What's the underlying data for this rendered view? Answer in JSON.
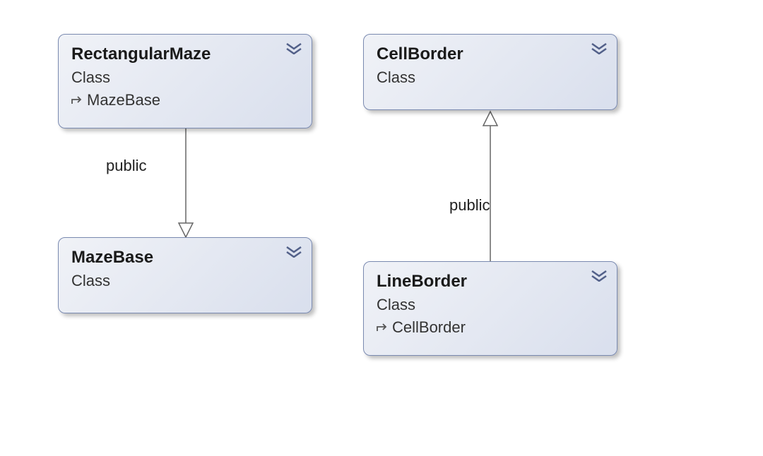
{
  "classes": {
    "rectangularMaze": {
      "name": "RectangularMaze",
      "type": "Class",
      "inherits": "MazeBase"
    },
    "mazeBase": {
      "name": "MazeBase",
      "type": "Class"
    },
    "cellBorder": {
      "name": "CellBorder",
      "type": "Class"
    },
    "lineBorder": {
      "name": "LineBorder",
      "type": "Class",
      "inherits": "CellBorder"
    }
  },
  "relations": {
    "left": {
      "label": "public",
      "from": "RectangularMaze",
      "to": "MazeBase"
    },
    "right": {
      "label": "public",
      "from": "LineBorder",
      "to": "CellBorder"
    }
  }
}
